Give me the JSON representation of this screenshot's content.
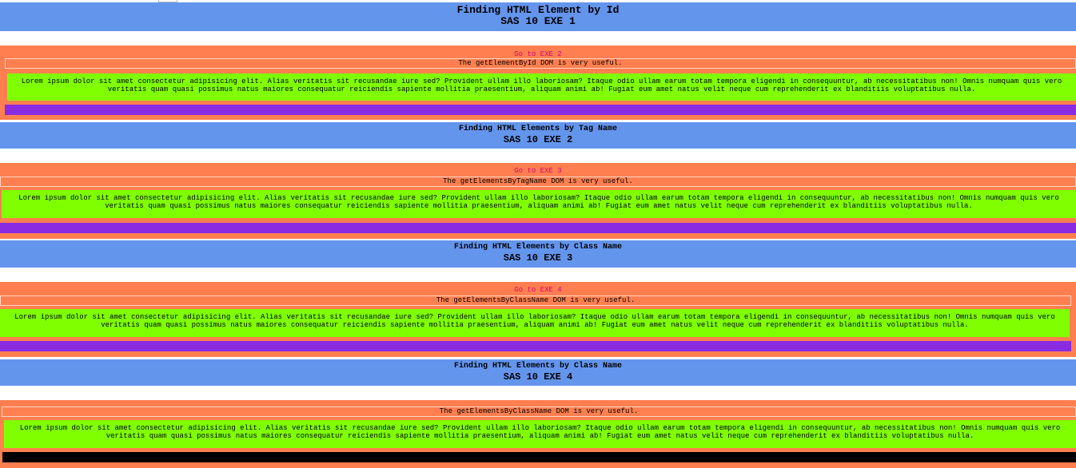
{
  "sections": [
    {
      "title": "Finding HTML Element by Id",
      "subtitle": "SAS 10 EXE 1",
      "link": "Go to EXE 2",
      "useful_pre": "The ",
      "useful_method": "getElementById",
      "useful_post": " DOM is very useful.",
      "lorem": "Lorem ipsum dolor sit amet consectetur adipisicing elit. Alias veritatis sit recusandae iure sed? Provident ullam illo laboriosam? Itaque odio ullam earum totam tempora eligendi in consequuntur, ab necessitatibus non! Omnis numquam quis vero veritatis quam quasi possimus natus maiores consequatur reiciendis sapiente mollitia praesentium, aliquam animi ab! Fugiat eum amet natus velit neque cum reprehenderit ex blanditiis voluptatibus nulla.",
      "bar_color": "#8A2BE2"
    },
    {
      "title": "Finding HTML Elements by Tag Name",
      "subtitle": "SAS 10 EXE 2",
      "link": "Go to EXE 3",
      "useful_pre": "The ",
      "useful_method": "getElementsByTagName",
      "useful_post": " DOM is very useful.",
      "lorem": "Lorem ipsum dolor sit amet consectetur adipisicing elit. Alias veritatis sit recusandae iure sed? Provident ullam illo laboriosam? Itaque odio ullam earum totam tempora eligendi in consequuntur, ab necessitatibus non! Omnis numquam quis vero veritatis quam quasi possimus natus maiores consequatur reiciendis sapiente mollitia praesentium, aliquam animi ab! Fugiat eum amet natus velit neque cum reprehenderit ex blanditiis voluptatibus nulla.",
      "bar_color": "#8A2BE2"
    },
    {
      "title": "Finding HTML Elements by Class Name",
      "subtitle": "SAS 10 EXE 3",
      "link": "Go to EXE 4",
      "useful_pre": "The ",
      "useful_method": "getElementsByClassName",
      "useful_post": " DOM is very useful.",
      "lorem": "Lorem ipsum dolor sit amet consectetur adipisicing elit. Alias veritatis sit recusandae iure sed? Provident ullam illo laboriosam? Itaque odio ullam earum totam tempora eligendi in consequuntur, ab necessitatibus non! Omnis numquam quis vero veritatis quam quasi possimus natus maiores consequatur reiciendis sapiente mollitia praesentium, aliquam animi ab! Fugiat eum amet natus velit neque cum reprehenderit ex blanditiis voluptatibus nulla.",
      "bar_color": "#8A2BE2"
    },
    {
      "title": "Finding HTML Elements by Class Name",
      "subtitle": "SAS 10 EXE 4",
      "link": "",
      "useful_pre": "The ",
      "useful_method": "getElementsByClassName",
      "useful_post": " DOM is very useful.",
      "lorem": "Lorem ipsum dolor sit amet consectetur adipisicing elit. Alias veritatis sit recusandae iure sed? Provident ullam illo laboriosam? Itaque odio ullam earum totam tempora eligendi in consequuntur, ab necessitatibus non! Omnis numquam quis vero veritatis quam quasi possimus natus maiores consequatur reiciendis sapiente mollitia praesentium, aliquam animi ab! Fugiat eum amet natus velit neque cum reprehenderit ex blanditiis voluptatibus nulla.",
      "bar_color": "#000000"
    }
  ],
  "colors": {
    "header": "#6495ED",
    "section": "#FF7F50",
    "lorem": "#7FFF00",
    "link": "#e0007a"
  }
}
